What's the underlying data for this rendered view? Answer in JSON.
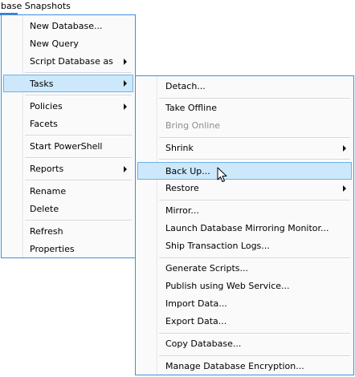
{
  "tree": {
    "node_label": "base Snapshots"
  },
  "menu": {
    "items": [
      {
        "label": "New Database..."
      },
      {
        "label": "New Query"
      },
      {
        "label": "Script Database as"
      },
      {
        "label": "Tasks"
      },
      {
        "label": "Policies"
      },
      {
        "label": "Facets"
      },
      {
        "label": "Start PowerShell"
      },
      {
        "label": "Reports"
      },
      {
        "label": "Rename"
      },
      {
        "label": "Delete"
      },
      {
        "label": "Refresh"
      },
      {
        "label": "Properties"
      }
    ]
  },
  "submenu": {
    "items": [
      {
        "label": "Detach..."
      },
      {
        "label": "Take Offline"
      },
      {
        "label": "Bring Online",
        "disabled": true
      },
      {
        "label": "Shrink"
      },
      {
        "label": "Back Up..."
      },
      {
        "label": "Restore"
      },
      {
        "label": "Mirror..."
      },
      {
        "label": "Launch Database Mirroring Monitor..."
      },
      {
        "label": "Ship Transaction Logs..."
      },
      {
        "label": "Generate Scripts..."
      },
      {
        "label": "Publish using Web Service..."
      },
      {
        "label": "Import Data..."
      },
      {
        "label": "Export Data..."
      },
      {
        "label": "Copy Database..."
      },
      {
        "label": "Manage Database Encryption..."
      }
    ]
  },
  "colors": {
    "menu_border": "#3d8fe0",
    "highlight_bg": "#cde8fb",
    "highlight_border": "#6eb1ea",
    "disabled_text": "#8d8d8d"
  }
}
